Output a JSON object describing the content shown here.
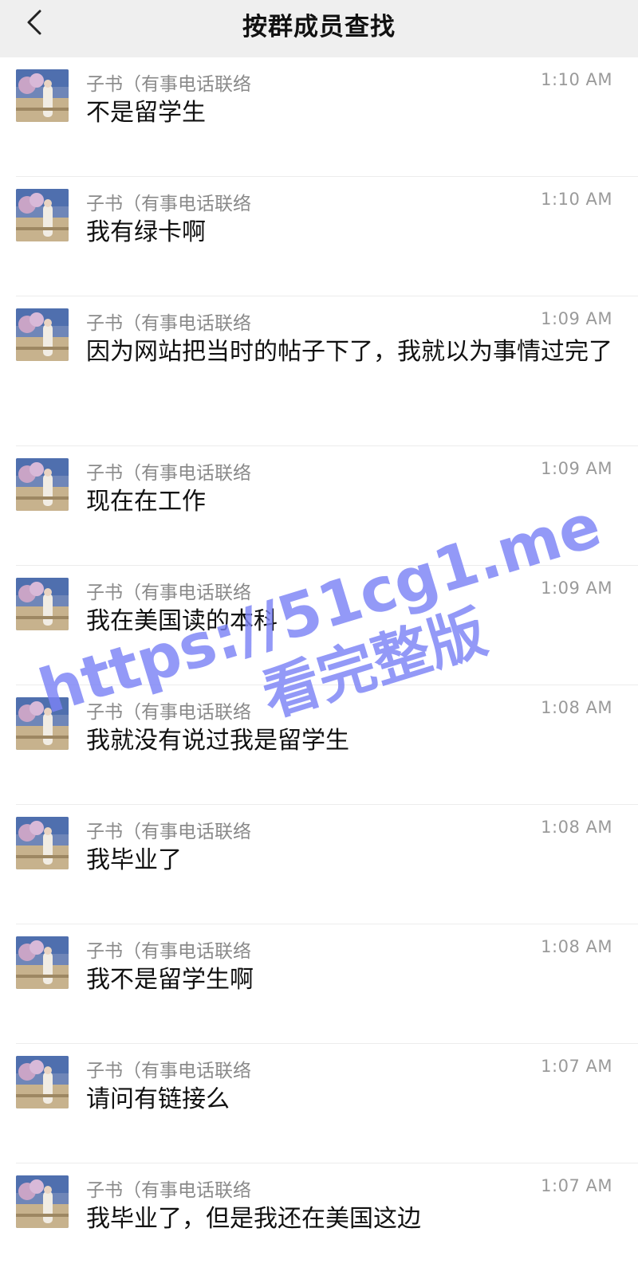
{
  "header": {
    "title": "按群成员查找",
    "back_icon": "chevron-left-icon"
  },
  "messages": [
    {
      "sender": "子书（有事电话联络",
      "time": "1:10 AM",
      "text": "不是留学生"
    },
    {
      "sender": "子书（有事电话联络",
      "time": "1:10 AM",
      "text": "我有绿卡啊"
    },
    {
      "sender": "子书（有事电话联络",
      "time": "1:09 AM",
      "text": "因为网站把当时的帖子下了，我就以为事情过完了"
    },
    {
      "sender": "子书（有事电话联络",
      "time": "1:09 AM",
      "text": "现在在工作"
    },
    {
      "sender": "子书（有事电话联络",
      "time": "1:09 AM",
      "text": "我在美国读的本科"
    },
    {
      "sender": "子书（有事电话联络",
      "time": "1:08 AM",
      "text": "我就没有说过我是留学生"
    },
    {
      "sender": "子书（有事电话联络",
      "time": "1:08 AM",
      "text": "我毕业了"
    },
    {
      "sender": "子书（有事电话联络",
      "time": "1:08 AM",
      "text": "我不是留学生啊"
    },
    {
      "sender": "子书（有事电话联络",
      "time": "1:07 AM",
      "text": "请问有链接么"
    },
    {
      "sender": "子书（有事电话联络",
      "time": "1:07 AM",
      "text": "我毕业了，但是我还在美国这边"
    }
  ],
  "watermark": {
    "line1": "https://51cg1.me",
    "line2": "看完整版",
    "color": "#7b82f5"
  }
}
